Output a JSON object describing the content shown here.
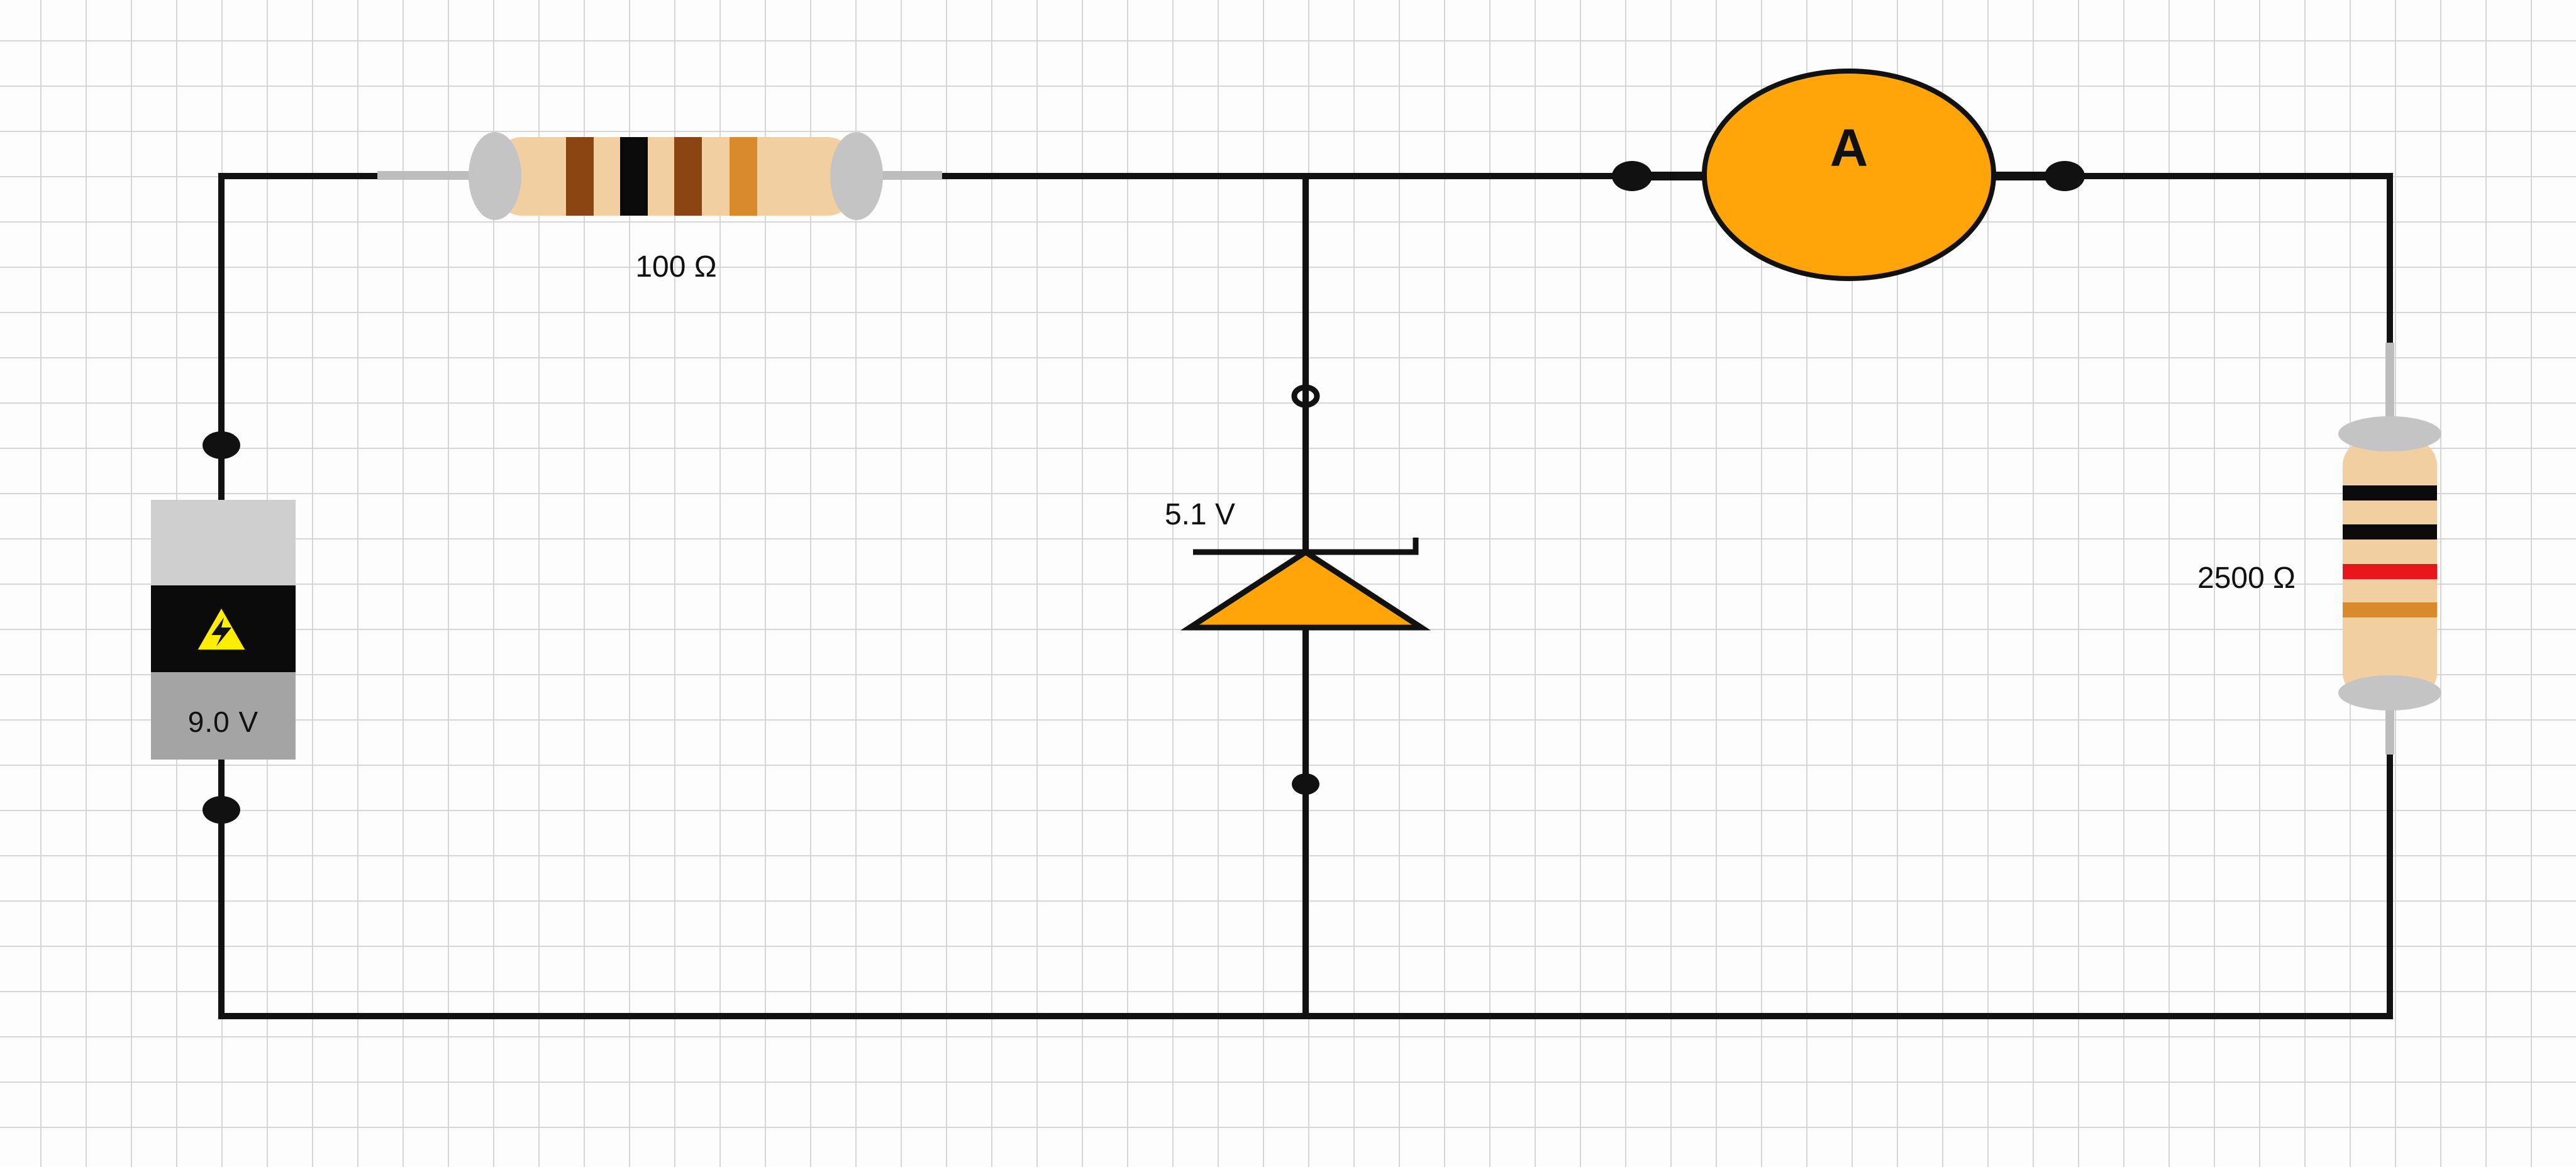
{
  "colors": {
    "grid_line": "#d6d6d6",
    "wire": "#111111",
    "resistor_body": "#f2cfa0",
    "lead_cap": "#c4c4c4",
    "ammeter_fill": "#ffa50a",
    "zener_fill": "#ffa50a",
    "battery_top": "#cfcfcf",
    "battery_band": "#0a0a0a",
    "battery_bottom": "#a4a4a4",
    "warning_yellow": "#ffee00"
  },
  "battery": {
    "label": "9.0 V",
    "icon": "high-voltage-warning-icon"
  },
  "resistor_top": {
    "label": "100 Ω",
    "bands": [
      "#8b4513",
      "#0a0a0a",
      "#8b4513",
      "#d98a2b"
    ]
  },
  "zener_diode": {
    "label": "5.1 V"
  },
  "ammeter": {
    "symbol": "A"
  },
  "resistor_right": {
    "label": "2500 Ω",
    "bands": [
      "#0a0a0a",
      "#0a0a0a",
      "#e8161b",
      "#d98a2b"
    ]
  }
}
